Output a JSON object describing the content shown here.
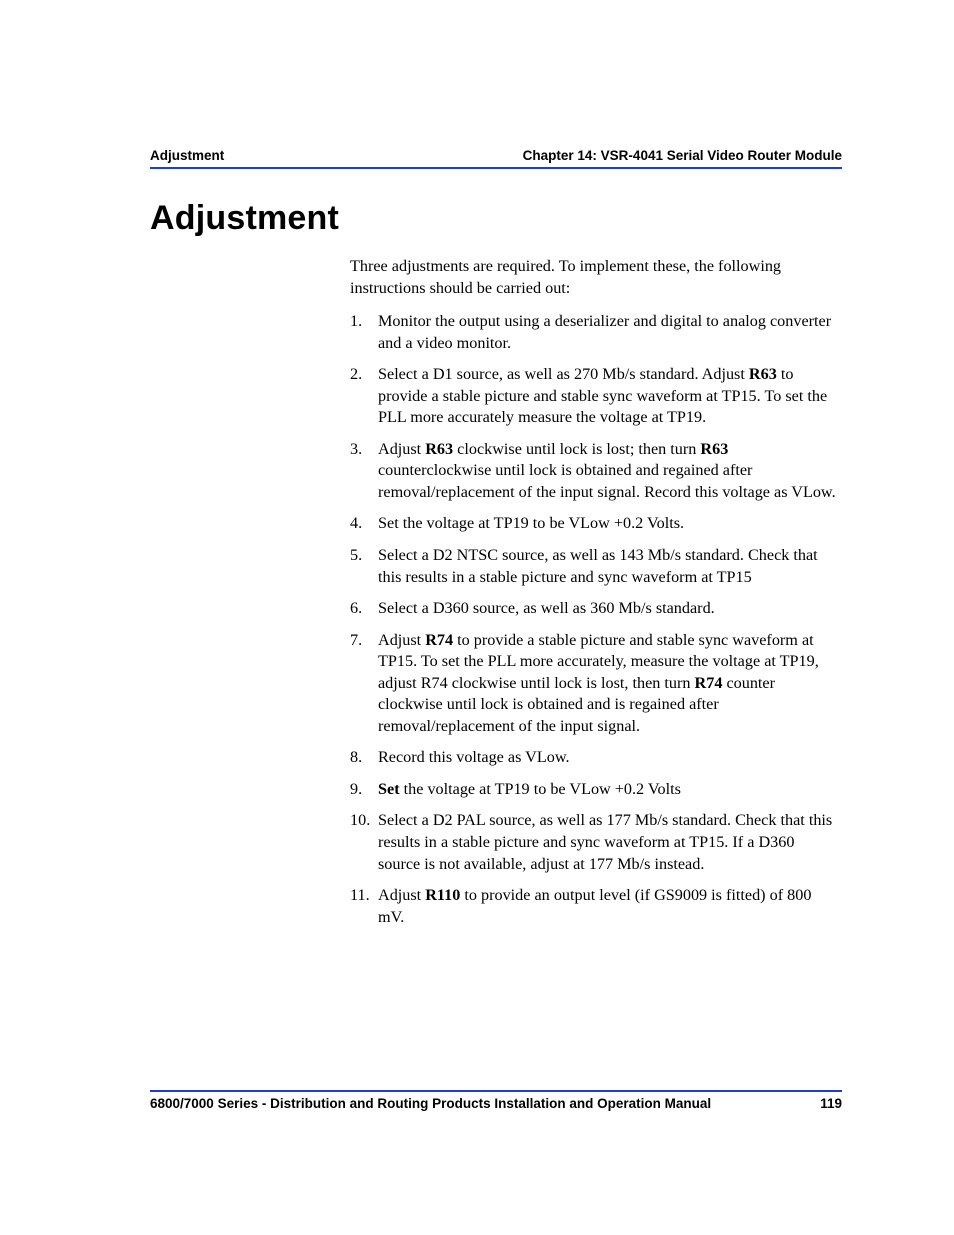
{
  "header": {
    "left": "Adjustment",
    "right": "Chapter 14: VSR-4041 Serial Video Router Module"
  },
  "title": "Adjustment",
  "intro": "Three adjustments are required. To implement these, the following instructions should be carried out:",
  "steps": [
    {
      "parts": [
        {
          "t": "Monitor the output using a deserializer and digital to analog converter and a video monitor."
        }
      ]
    },
    {
      "parts": [
        {
          "t": "Select a D1 source, as well as 270 Mb/s standard. Adjust "
        },
        {
          "t": "R63",
          "b": true
        },
        {
          "t": " to provide a stable picture and stable sync waveform at TP15. To set the PLL more accurately measure the voltage at TP19."
        }
      ]
    },
    {
      "parts": [
        {
          "t": "Adjust "
        },
        {
          "t": "R63",
          "b": true
        },
        {
          "t": " clockwise until lock is lost; then turn "
        },
        {
          "t": "R63",
          "b": true
        },
        {
          "t": " counterclockwise until lock is obtained and regained after removal/replacement of the input signal. Record this voltage as VLow."
        }
      ]
    },
    {
      "parts": [
        {
          "t": "Set the voltage at TP19 to be VLow +0.2 Volts."
        }
      ]
    },
    {
      "parts": [
        {
          "t": "Select a D2 NTSC source, as well as 143 Mb/s standard. Check that this results in a stable picture and sync waveform at TP15"
        }
      ]
    },
    {
      "parts": [
        {
          "t": "Select a D360 source, as well as 360 Mb/s standard."
        }
      ]
    },
    {
      "parts": [
        {
          "t": "Adjust "
        },
        {
          "t": "R74",
          "b": true
        },
        {
          "t": " to provide a stable picture and stable sync waveform at TP15. To set the PLL more accurately, measure the voltage at TP19, adjust R74 clockwise until lock is lost, then turn "
        },
        {
          "t": "R74",
          "b": true
        },
        {
          "t": " counter clockwise until lock is obtained and is regained after removal/replacement of the input signal."
        }
      ]
    },
    {
      "parts": [
        {
          "t": "Record this voltage as VLow."
        }
      ]
    },
    {
      "parts": [
        {
          "t": "Set",
          "b": true
        },
        {
          "t": " the voltage at TP19 to be VLow +0.2 Volts"
        }
      ]
    },
    {
      "parts": [
        {
          "t": "Select a D2 PAL source, as well as 177 Mb/s standard. Check that this results in a stable picture and sync waveform at TP15. If a D360 source is not available, adjust at 177 Mb/s instead."
        }
      ]
    },
    {
      "parts": [
        {
          "t": "Adjust "
        },
        {
          "t": "R110",
          "b": true
        },
        {
          "t": " to provide an output level (if GS9009 is fitted) of 800 mV."
        }
      ]
    }
  ],
  "footer": {
    "left": "6800/7000 Series - Distribution and Routing Products Installation and Operation Manual",
    "right": "119"
  }
}
